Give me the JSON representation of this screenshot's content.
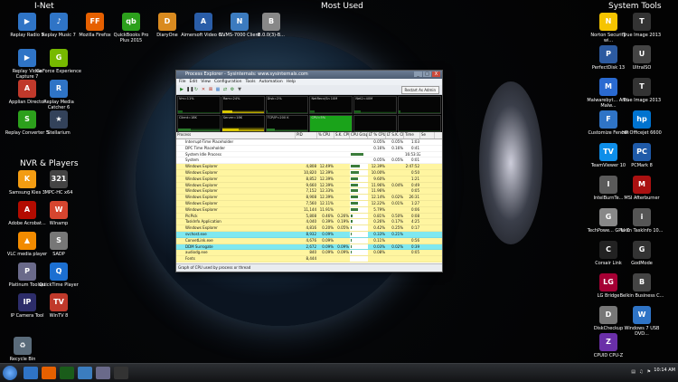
{
  "desktop": {
    "headers": {
      "inet": "I-Net",
      "most_used": "Most Used",
      "system_tools": "System Tools",
      "nvr": "NVR & Players"
    },
    "icons": [
      {
        "id": "replay-radio",
        "label": "Replay Radio 5",
        "color": "#2f74c6",
        "g": "▶"
      },
      {
        "id": "replay-music",
        "label": "Replay Music 7",
        "color": "#2f74c6",
        "g": "♪"
      },
      {
        "id": "firefox",
        "label": "Mozilla Firefox",
        "color": "#e66000",
        "g": "FF"
      },
      {
        "id": "quickbooks",
        "label": "QuickBooks Pro Plus 2015",
        "color": "#2ca01c",
        "g": "qb"
      },
      {
        "id": "diaryone",
        "label": "DiaryOne",
        "color": "#d98a1f",
        "g": "D"
      },
      {
        "id": "aimersoft",
        "label": "Aimersoft Video C...",
        "color": "#2a5da8",
        "g": "A"
      },
      {
        "id": "nvms",
        "label": "NVMS-7000 Client",
        "color": "#3c7bbf",
        "g": "N"
      },
      {
        "id": "bb",
        "label": "B.0.0(3)-B...",
        "color": "#888",
        "g": "B"
      },
      {
        "id": "replay-video",
        "label": "Replay Video Capture 7",
        "color": "#2f74c6",
        "g": "▶"
      },
      {
        "id": "geforce",
        "label": "GeForce Experience",
        "color": "#76b900",
        "g": "G"
      },
      {
        "id": "appian",
        "label": "Applian Director",
        "color": "#c0392b",
        "g": "A"
      },
      {
        "id": "replay-media",
        "label": "Replay Media Catcher 6",
        "color": "#2f74c6",
        "g": "R"
      },
      {
        "id": "replay-conv",
        "label": "Replay Converter 5",
        "color": "#2ca01c",
        "g": "S"
      },
      {
        "id": "stellarium",
        "label": "Stellarium",
        "color": "#33425a",
        "g": "★"
      },
      {
        "id": "samsung-kies",
        "label": "Samsung Kies 3",
        "color": "#f39c12",
        "g": "K"
      },
      {
        "id": "mpc",
        "label": "MPC-HC x64",
        "color": "#444",
        "g": "321"
      },
      {
        "id": "acrobat",
        "label": "Adobe Acrobat...",
        "color": "#b30b00",
        "g": "A"
      },
      {
        "id": "winamp",
        "label": "Winamp",
        "color": "#d6452f",
        "g": "W"
      },
      {
        "id": "vlc",
        "label": "VLC media player",
        "color": "#f28b00",
        "g": "▲"
      },
      {
        "id": "sadp",
        "label": "SADP",
        "color": "#777",
        "g": "S"
      },
      {
        "id": "platinum",
        "label": "Platinum Toolset",
        "color": "#6a6a8a",
        "g": "P"
      },
      {
        "id": "quicktime",
        "label": "QuickTime Player",
        "color": "#1c6fd1",
        "g": "Q"
      },
      {
        "id": "ipcam",
        "label": "IP Camera Tool",
        "color": "#2d2d6a",
        "g": "IP"
      },
      {
        "id": "wintv",
        "label": "WinTV 8",
        "color": "#c0392b",
        "g": "TV"
      },
      {
        "id": "recycle",
        "label": "Recycle Bin",
        "color": "#5a6b7a",
        "g": "♻"
      },
      {
        "id": "norton",
        "label": "Norton Security wi...",
        "color": "#f5c400",
        "g": "N"
      },
      {
        "id": "trueimage13",
        "label": "True Image 2013",
        "color": "#333",
        "g": "T"
      },
      {
        "id": "perfectdisk",
        "label": "PerfectDisk 13",
        "color": "#2c5aa0",
        "g": "P"
      },
      {
        "id": "ultraiso",
        "label": "UltraISO",
        "color": "#444",
        "g": "U"
      },
      {
        "id": "malwarebytes",
        "label": "Malwarebyt... Anti-Malw...",
        "color": "#2a6ad1",
        "g": "M"
      },
      {
        "id": "trueimage13b",
        "label": "True Image 2013",
        "color": "#333",
        "g": "T"
      },
      {
        "id": "fences",
        "label": "Customize Fences",
        "color": "#2f74c6",
        "g": "F"
      },
      {
        "id": "hpofficejet",
        "label": "HP Officejet 6600",
        "color": "#0073cf",
        "g": "hp"
      },
      {
        "id": "teamviewer",
        "label": "TeamViewer 10",
        "color": "#0e8ee9",
        "g": "TV"
      },
      {
        "id": "pcmark",
        "label": "PCMark 8",
        "color": "#1f5aa8",
        "g": "PC"
      },
      {
        "id": "intelburn",
        "label": "IntelBurnTe...",
        "color": "#5a5a5a",
        "g": "I"
      },
      {
        "id": "msi",
        "label": "MSI Afterburner",
        "color": "#aa1111",
        "g": "M"
      },
      {
        "id": "techpowerup",
        "label": "TechPowe... GPU-Z",
        "color": "#888",
        "g": "G"
      },
      {
        "id": "tasklnfo",
        "label": "Iarsn TaskInfo 10...",
        "color": "#555",
        "g": "i"
      },
      {
        "id": "corsair",
        "label": "Corsair Link",
        "color": "#222",
        "g": "C"
      },
      {
        "id": "godmode",
        "label": "GodMode",
        "color": "#333",
        "g": "G"
      },
      {
        "id": "lgbridge",
        "label": "LG Bridge",
        "color": "#a50034",
        "g": "LG"
      },
      {
        "id": "belkin",
        "label": "Belkin Business C...",
        "color": "#444",
        "g": "B"
      },
      {
        "id": "diskcheckup",
        "label": "DiskCheckup",
        "color": "#777",
        "g": "D"
      },
      {
        "id": "win7usb",
        "label": "Windows 7 USB DVD...",
        "color": "#2f74c6",
        "g": "W"
      },
      {
        "id": "cpuz",
        "label": "CPUID CPU-Z",
        "color": "#6a2fa8",
        "g": "Z"
      }
    ]
  },
  "window": {
    "title": "Process Explorer - Sysinternals: www.sysinternals.com",
    "controls": [
      "_",
      "□",
      "X"
    ],
    "menu": [
      "File",
      "Edit",
      "View",
      "Configuration",
      "Tools",
      "Automation",
      "Help"
    ],
    "restart_label": "Restart As Admin",
    "meters": [
      {
        "label": "Vm=11%",
        "color": "#1a5c1a",
        "fill": 0.11
      },
      {
        "label": "Ram=24%",
        "color": "#d9c700",
        "fill": 0.24
      },
      {
        "label": "Disk=2%",
        "color": "#1a5c1a",
        "fill": 0.02
      },
      {
        "label": "NetRecv/Sn 10M",
        "color": "#1a5c1a",
        "fill": 0.1
      },
      {
        "label": "Net2=40M",
        "color": "#1a5c1a",
        "fill": 0.15
      },
      {
        "label": "",
        "color": "#1a5c1a",
        "fill": 0.05
      },
      {
        "label": "Client=18K",
        "color": "#2b7b2b",
        "fill": 0.3
      },
      {
        "label": "Server=18K",
        "color": "#d9c700",
        "fill": 0.4
      },
      {
        "label": "TCP/IP=200 K",
        "color": "#2b7b2b",
        "fill": 0.2
      },
      {
        "label": "CPU=5%",
        "color": "#1aa31a",
        "fill": 1.0
      },
      {
        "label": "",
        "color": "#1a5c1a",
        "fill": 0.0
      },
      {
        "label": "",
        "color": "#1a5c1a",
        "fill": 0.0
      }
    ],
    "columns": [
      "Process",
      "PID",
      "% CPU",
      "S.K. CPU",
      "CPU Graph",
      "LT % CPU",
      "LT S.K. CPU",
      "Time",
      "Se"
    ],
    "rows": [
      {
        "name": "Interrupt-Time Placeholder",
        "pid": "",
        "cpu": "",
        "sk": "",
        "g": 0,
        "lt": "0.05%",
        "lts": "0.05%",
        "time": "1:03",
        "bg": "#ffffff"
      },
      {
        "name": "DPC Time Placeholder",
        "pid": "",
        "cpu": "",
        "sk": "",
        "g": 0,
        "lt": "0.16%",
        "lts": "0.16%",
        "time": "0:41",
        "bg": "#ffffff"
      },
      {
        "name": "System Idle Process",
        "pid": "",
        "cpu": "",
        "sk": "",
        "g": 0.9,
        "lt": "",
        "lts": "",
        "time": "16:53:32",
        "bg": "#ffffff"
      },
      {
        "name": "System",
        "pid": "",
        "cpu": "",
        "sk": "",
        "g": 0,
        "lt": "0.05%",
        "lts": "0.05%",
        "time": "0:01",
        "bg": "#ffffff"
      },
      {
        "name": "Windows Explorer",
        "pid": "4,808",
        "cpu": "12.49%",
        "sk": "",
        "g": 0.6,
        "lt": "12.39%",
        "lts": "",
        "time": "2:47:52",
        "bg": "#fff5a0"
      },
      {
        "name": "Windows Explorer",
        "pid": "10,820",
        "cpu": "12.39%",
        "sk": "",
        "g": 0.55,
        "lt": "10.00%",
        "lts": "",
        "time": "0:50",
        "bg": "#fff5a0"
      },
      {
        "name": "Windows Explorer",
        "pid": "8,852",
        "cpu": "12.39%",
        "sk": "",
        "g": 0.5,
        "lt": "9.60%",
        "lts": "",
        "time": "1:21",
        "bg": "#fff5a0"
      },
      {
        "name": "Windows Explorer",
        "pid": "9,660",
        "cpu": "12.39%",
        "sk": "",
        "g": 0.5,
        "lt": "11.96%",
        "lts": "0.04%",
        "time": "0:49",
        "bg": "#fff5a0"
      },
      {
        "name": "Windows Explorer",
        "pid": "7,152",
        "cpu": "12.33%",
        "sk": "",
        "g": 0.5,
        "lt": "11.96%",
        "lts": "",
        "time": "0:05",
        "bg": "#fff5a0"
      },
      {
        "name": "Windows Explorer",
        "pid": "8,908",
        "cpu": "12.39%",
        "sk": "",
        "g": 0.5,
        "lt": "12.14%",
        "lts": "0.02%",
        "time": "26:31",
        "bg": "#fff5a0"
      },
      {
        "name": "Windows Explorer",
        "pid": "7,560",
        "cpu": "12.11%",
        "sk": "",
        "g": 0.5,
        "lt": "12.22%",
        "lts": "0.01%",
        "time": "1:27",
        "bg": "#fff5a0"
      },
      {
        "name": "Windows Explorer",
        "pid": "11,144",
        "cpu": "11.91%",
        "sk": "",
        "g": 0.5,
        "lt": "5.79%",
        "lts": "",
        "time": "0:06",
        "bg": "#fff5a0"
      },
      {
        "name": "PicPick",
        "pid": "5,808",
        "cpu": "0.46%",
        "sk": "0.26%",
        "g": 0.1,
        "lt": "0.81%",
        "lts": "0.50%",
        "time": "0:08",
        "bg": "#fff5a0"
      },
      {
        "name": "TaskInfo Application",
        "pid": "4,040",
        "cpu": "0.39%",
        "sk": "0.19%",
        "g": 0.1,
        "lt": "0.26%",
        "lts": "0.17%",
        "time": "4:25",
        "bg": "#fff5a0"
      },
      {
        "name": "Windows Explorer",
        "pid": "4,816",
        "cpu": "0.20%",
        "sk": "0.05%",
        "g": 0.05,
        "lt": "0.42%",
        "lts": "0.25%",
        "time": "0:17",
        "bg": "#fff5a0"
      },
      {
        "name": "svchost.exe",
        "pid": "8,932",
        "cpu": "0.09%",
        "sk": "",
        "g": 0.02,
        "lt": "0.33%",
        "lts": "0.21%",
        "time": "",
        "bg": "#7fe8f0"
      },
      {
        "name": "ConvetLink.exe",
        "pid": "4,676",
        "cpu": "0.09%",
        "sk": "",
        "g": 0.02,
        "lt": "0.11%",
        "lts": "",
        "time": "0:56",
        "bg": "#fff5a0"
      },
      {
        "name": "DDM Surrogate",
        "pid": "2,672",
        "cpu": "0.09%",
        "sk": "0.09%",
        "g": 0.02,
        "lt": "0.03%",
        "lts": "0.02%",
        "time": "0:39",
        "bg": "#7fe8f0"
      },
      {
        "name": "audiodg.exe",
        "pid": "840",
        "cpu": "0.09%",
        "sk": "0.09%",
        "g": 0.02,
        "lt": "0.08%",
        "lts": "",
        "time": "0:05",
        "bg": "#fff5a0"
      },
      {
        "name": "Fonts",
        "pid": "8,444",
        "cpu": "",
        "sk": "",
        "g": 0,
        "lt": "",
        "lts": "",
        "time": "",
        "bg": "#fff5a0"
      }
    ],
    "status": "Graph of CPU used by process or thread"
  },
  "taskbar": {
    "clock_time": "10:14 AM",
    "apps": [
      "#2f74c6",
      "#e66000",
      "#1a5c1a",
      "#3b7dbf",
      "#6a6a8a",
      "#333"
    ]
  }
}
